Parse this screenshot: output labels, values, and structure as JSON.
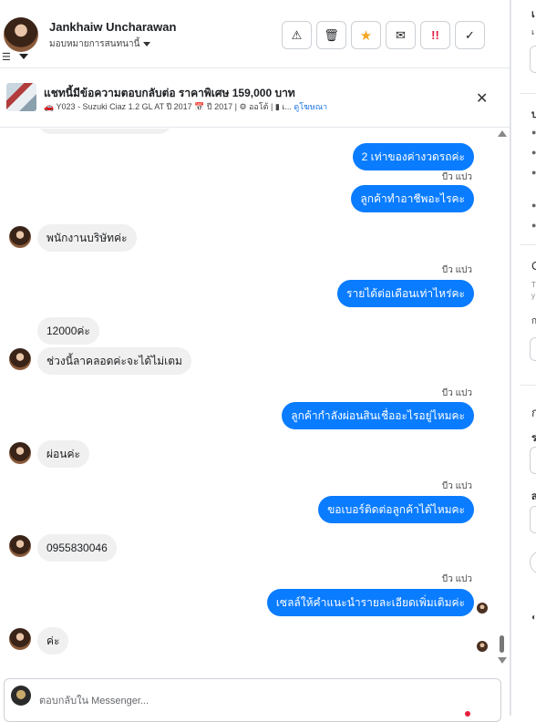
{
  "header": {
    "contact_name": "Jankhaiw Uncharawan",
    "assign_label": "มอบหมายการสนทนานี้",
    "actions": [
      {
        "name": "report-spam-button",
        "icon": "⚠"
      },
      {
        "name": "delete-button",
        "icon": "🗑"
      },
      {
        "name": "star-button",
        "icon": "★"
      },
      {
        "name": "mark-unread-button",
        "icon": "✉"
      },
      {
        "name": "mark-important-button",
        "icon": "!!"
      },
      {
        "name": "mark-done-button",
        "icon": "✓"
      }
    ]
  },
  "ad_banner": {
    "title": "แชทนี้มีข้อความตอบกลับต่อ ราคาพิเศษ 159,000 บาท",
    "meta": "🚗 Y023 - Suzuki Ciaz 1.2 GL AT ปี 2017 📅 ปี 2017 | ⚙ ออโต้ | ▮ เ...",
    "view_ad_link": "ดูโฆษณา",
    "close_icon": "✕"
  },
  "messages": [
    {
      "dir": "out",
      "text": "2 เท่าของค่างวดรถค่ะ"
    },
    {
      "dir": "out",
      "sender": "บีว แปว",
      "text": "ลูกค้าทำอาชีพอะไรคะ"
    },
    {
      "dir": "in",
      "text": "พนักงานบริษัทค่ะ"
    },
    {
      "dir": "out",
      "sender": "บีว แปว",
      "text": "รายได้ต่อเดือนเท่าไหร่คะ"
    },
    {
      "dir": "in",
      "text": "12000ค่ะ"
    },
    {
      "dir": "in",
      "text": "ช่วงนี้ลาคลอดค่ะจะได้ไม่เตม"
    },
    {
      "dir": "out",
      "sender": "บีว แปว",
      "text": "ลูกค้ากำลังผ่อนสินเชื่ออะไรอยู่ไหมคะ"
    },
    {
      "dir": "in",
      "text": "ผ่อนค่ะ"
    },
    {
      "dir": "out",
      "sender": "บีว แปว",
      "text": "ขอเบอร์ติดต่อลูกค้าได้ไหมคะ"
    },
    {
      "dir": "in",
      "text": "0955830046"
    },
    {
      "dir": "out",
      "sender": "บีว แปว",
      "text": "เซลล์ให้คำแนะนำรายละเอียดเพิ่มเติมค่ะ"
    },
    {
      "dir": "in",
      "text": "ค่ะ"
    }
  ],
  "composer": {
    "placeholder": "ตอบกลับใน Messenger..."
  },
  "side_panel": {
    "cut_labels": [
      "เ",
      "เ",
      "บ",
      "C",
      "T",
      "y",
      "ก",
      "ก",
      "ร",
      "ส"
    ]
  },
  "colors": {
    "outgoing_bubble": "#0a7cff",
    "incoming_bubble": "#f0f0f0",
    "link": "#1b74e4",
    "star": "#f5a623",
    "important": "#e41e3f"
  }
}
